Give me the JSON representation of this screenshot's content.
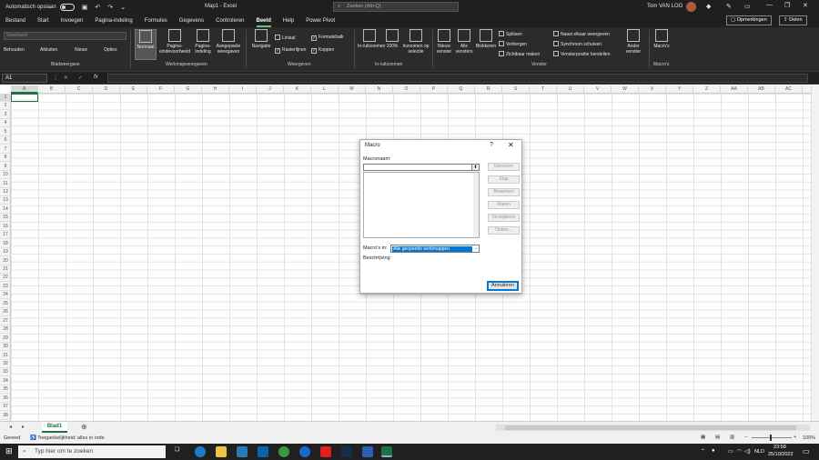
{
  "titlebar": {
    "autosave_label": "Automatisch opslaan",
    "doc_title": "Map1  -  Excel",
    "search_placeholder": "Zoeken (Alt+Q)",
    "user": "Tom VAN LOO"
  },
  "tabs": [
    "Bestand",
    "Start",
    "Invoegen",
    "Pagina-indeling",
    "Formules",
    "Gegevens",
    "Controleren",
    "Beeld",
    "Help",
    "Power Pivot"
  ],
  "active_tab": "Beeld",
  "topbuttons": {
    "comments": "Opmerkingen",
    "share": "Delen"
  },
  "ribbon": {
    "sheetview": {
      "dropdown": "Standaard",
      "keep": "Behouden",
      "exit": "Afsluiten",
      "new": "Nieuw",
      "options": "Opties",
      "label": "Bladweergave"
    },
    "workbookviews": {
      "normal": "Normaal",
      "pagebreak": "Pagina-eindevoorbeeld",
      "pagelayout": "Pagina-indeling",
      "custom": "Aangepaste weergaven",
      "label": "Werkmapweergaven"
    },
    "show": {
      "navigation": "Navigatie",
      "ruler": "Liniaal",
      "formulabar": "Formulebalk",
      "gridlines": "Rasterlijnen",
      "headings": "Koppen",
      "label": "Weergeven"
    },
    "zoom": {
      "zoom": "In-/uitzoomen",
      "hundred": "100%",
      "selection": "Inzoomen op selectie",
      "label": "In-/uitzoomen"
    },
    "window": {
      "newwin": "Nieuw venster",
      "arrange": "Alle vensters",
      "freeze": "Blokkeren",
      "split": "Splitsen",
      "hide": "Verbergen",
      "unhide": "Zichtbaar maken",
      "sidebyside": "Naast elkaar weergeven",
      "syncscroll": "Synchroon schuiven",
      "reset": "Vensterpositie herstellen",
      "switch": "Ander venster",
      "label": "Venster"
    },
    "macros": {
      "macros": "Macro's",
      "label": "Macro's"
    }
  },
  "formula_bar": {
    "namebox": "A1",
    "fx": "fx"
  },
  "columns": [
    "A",
    "B",
    "C",
    "D",
    "E",
    "F",
    "G",
    "H",
    "I",
    "J",
    "K",
    "L",
    "M",
    "N",
    "O",
    "P",
    "Q",
    "R",
    "S",
    "T",
    "U",
    "V",
    "W",
    "X",
    "Y",
    "Z",
    "AA",
    "AB",
    "AC"
  ],
  "rows": [
    "1",
    "2",
    "3",
    "4",
    "5",
    "6",
    "7",
    "8",
    "9",
    "10",
    "11",
    "12",
    "13",
    "14",
    "15",
    "16",
    "17",
    "18",
    "19",
    "20",
    "21",
    "22",
    "23",
    "24",
    "25",
    "26",
    "27",
    "28",
    "29",
    "30",
    "31",
    "32",
    "33",
    "34",
    "35",
    "36",
    "37",
    "38"
  ],
  "sheet_tab": "Blad1",
  "status": {
    "ready": "Gereed",
    "accessibility": "Toegankelijkheid: alles in orde",
    "zoom": "100%"
  },
  "dialog": {
    "title": "Macro",
    "help": "?",
    "close": "✕",
    "name_label": "Macronaam:",
    "run": "Uitvoeren",
    "step": "Stap",
    "edit": "Bewerken",
    "create": "Maken",
    "delete": "Verwijderen",
    "options": "Opties...",
    "macros_in_label": "Macro's in:",
    "macros_in_value": "Alle geopende werkmappen",
    "description_label": "Beschrijving",
    "cancel": "Annuleren"
  },
  "taskbar": {
    "search_placeholder": "Typ hier om te zoeken",
    "time": "23:58",
    "date": "25/10/2022",
    "lang": "NLD"
  }
}
